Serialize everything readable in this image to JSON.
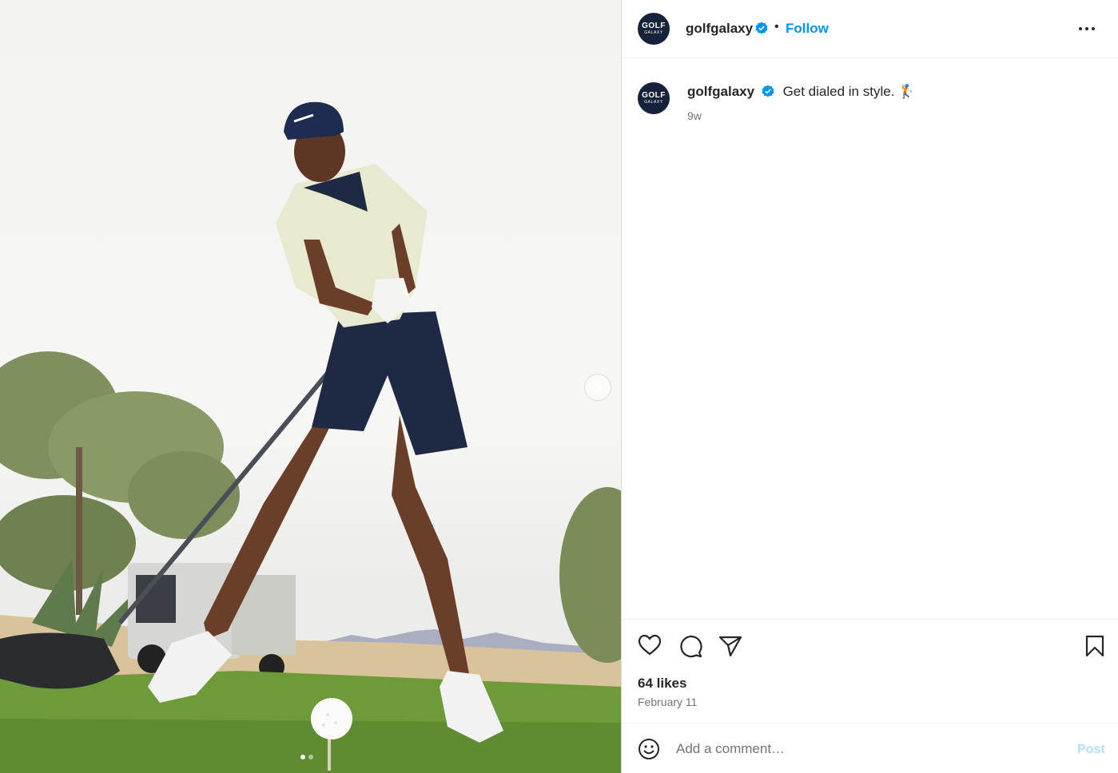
{
  "post": {
    "username": "golfgalaxy",
    "avatar_text_top": "GOLF",
    "avatar_text_bottom": "GALAXY",
    "follow_label": "Follow",
    "separator": "•",
    "caption": "Get dialed in style.",
    "caption_emoji": "🏌️",
    "time_ago": "9w",
    "likes": "64 likes",
    "date": "February 11",
    "comment_placeholder": "Add a comment…",
    "post_label": "Post",
    "carousel": {
      "total": 2,
      "current": 1
    }
  },
  "colors": {
    "accent": "#0095f6",
    "avatar_bg": "#16223a",
    "post_disabled": "#b2dffc",
    "muted": "#737373"
  },
  "icons": [
    "verified-badge-icon",
    "more-options-icon",
    "heart-icon",
    "comment-icon",
    "share-icon",
    "bookmark-icon",
    "emoji-icon",
    "chevron-right-icon"
  ]
}
